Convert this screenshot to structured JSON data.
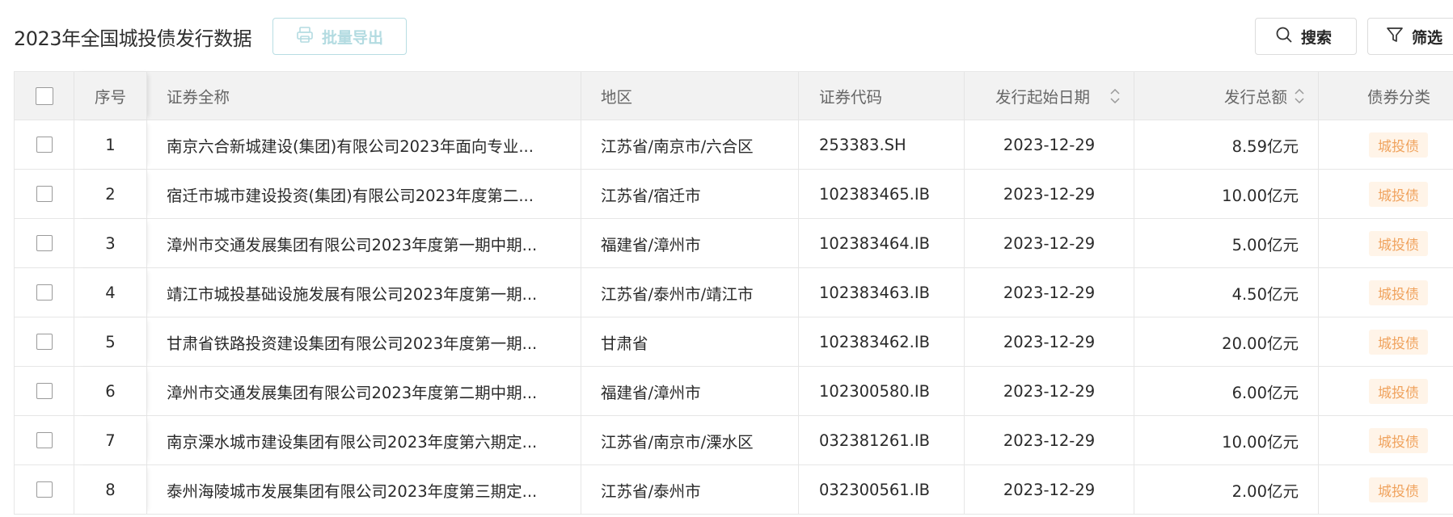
{
  "header": {
    "title": "2023年全国城投债发行数据",
    "export_label": "批量导出",
    "search_label": "搜索",
    "filter_label": "筛选"
  },
  "columns": {
    "seq": "序号",
    "name": "证券全称",
    "region": "地区",
    "code": "证券代码",
    "date": "发行起始日期",
    "amount": "发行总额",
    "category": "债券分类"
  },
  "rows": [
    {
      "seq": "1",
      "name": "南京六合新城建设(集团)有限公司2023年面向专业...",
      "region": "江苏省/南京市/六合区",
      "code": "253383.SH",
      "date": "2023-12-29",
      "amount": "8.59亿元",
      "category": "城投债"
    },
    {
      "seq": "2",
      "name": "宿迁市城市建设投资(集团)有限公司2023年度第二...",
      "region": "江苏省/宿迁市",
      "code": "102383465.IB",
      "date": "2023-12-29",
      "amount": "10.00亿元",
      "category": "城投债"
    },
    {
      "seq": "3",
      "name": "漳州市交通发展集团有限公司2023年度第一期中期...",
      "region": "福建省/漳州市",
      "code": "102383464.IB",
      "date": "2023-12-29",
      "amount": "5.00亿元",
      "category": "城投债"
    },
    {
      "seq": "4",
      "name": "靖江市城投基础设施发展有限公司2023年度第一期...",
      "region": "江苏省/泰州市/靖江市",
      "code": "102383463.IB",
      "date": "2023-12-29",
      "amount": "4.50亿元",
      "category": "城投债"
    },
    {
      "seq": "5",
      "name": "甘肃省铁路投资建设集团有限公司2023年度第一期...",
      "region": "甘肃省",
      "code": "102383462.IB",
      "date": "2023-12-29",
      "amount": "20.00亿元",
      "category": "城投债"
    },
    {
      "seq": "6",
      "name": "漳州市交通发展集团有限公司2023年度第二期中期...",
      "region": "福建省/漳州市",
      "code": "102300580.IB",
      "date": "2023-12-29",
      "amount": "6.00亿元",
      "category": "城投债"
    },
    {
      "seq": "7",
      "name": "南京溧水城市建设集团有限公司2023年度第六期定...",
      "region": "江苏省/南京市/溧水区",
      "code": "032381261.IB",
      "date": "2023-12-29",
      "amount": "10.00亿元",
      "category": "城投债"
    },
    {
      "seq": "8",
      "name": "泰州海陵城市发展集团有限公司2023年度第三期定...",
      "region": "江苏省/泰州市",
      "code": "032300561.IB",
      "date": "2023-12-29",
      "amount": "2.00亿元",
      "category": "城投债"
    }
  ]
}
